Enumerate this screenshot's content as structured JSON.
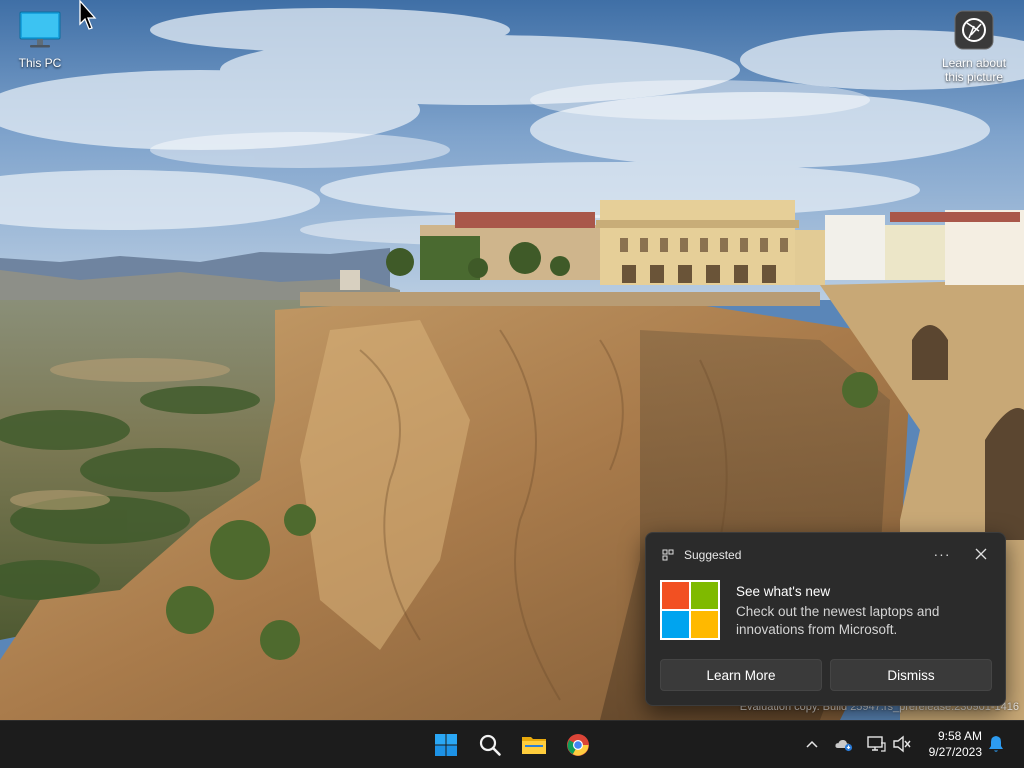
{
  "desktop": {
    "icons": [
      {
        "label": "This PC",
        "icon": "monitor-icon"
      },
      {
        "label": "Learn about this picture",
        "icon": "camera-icon"
      }
    ],
    "watermark": "Evaluation copy. Build 25947.rs_prerelease.230901-1416"
  },
  "toast": {
    "app_name": "Suggested",
    "title": "See what's new",
    "body": "Check out the newest laptops and innovations from Microsoft.",
    "more_label": "···",
    "primary_button": "Learn More",
    "secondary_button": "Dismiss",
    "logo_colors": [
      "#f25022",
      "#7fba00",
      "#00a4ef",
      "#ffb900"
    ]
  },
  "taskbar": {
    "pinned": [
      {
        "name": "Start",
        "icon": "windows-start-icon"
      },
      {
        "name": "Search",
        "icon": "search-icon"
      },
      {
        "name": "File Explorer",
        "icon": "folder-icon"
      },
      {
        "name": "Google Chrome",
        "icon": "chrome-icon"
      }
    ],
    "tray_icons": [
      "chevron-up-icon",
      "onedrive-icon",
      "network-icon",
      "volume-muted-icon",
      "notification-bell-icon"
    ],
    "clock": {
      "time": "9:58 AM",
      "date": "9/27/2023"
    }
  },
  "colors": {
    "taskbar_bg": "#1c1c1c",
    "toast_bg": "#2b2b2b",
    "accent": "#0078d4"
  }
}
